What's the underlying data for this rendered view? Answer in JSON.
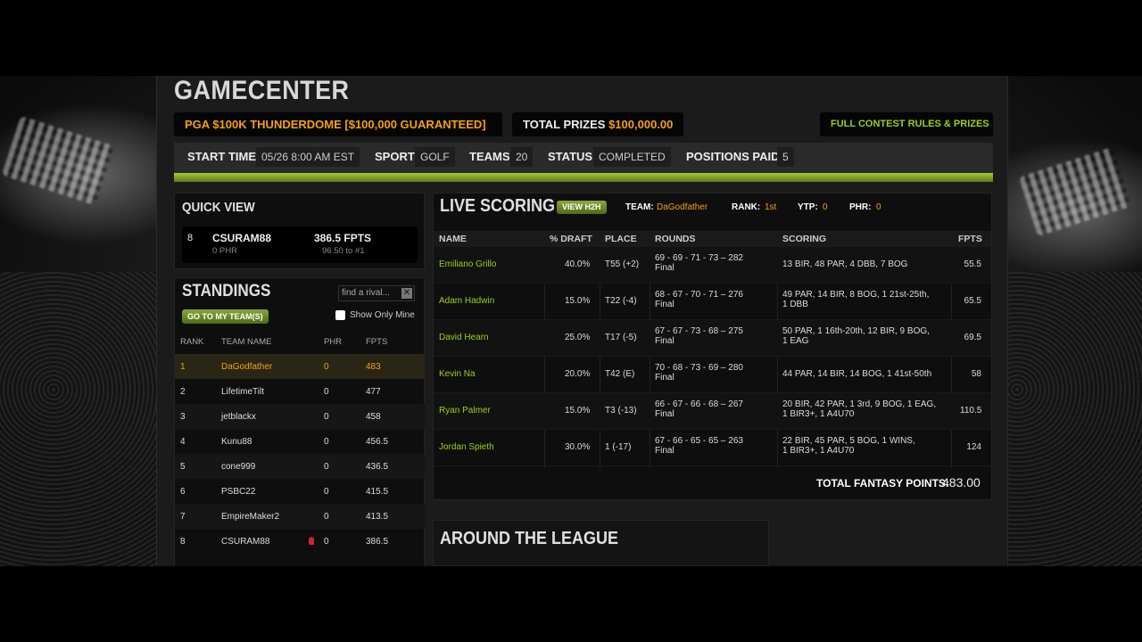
{
  "page": {
    "title": "GAMECENTER",
    "contest_name": "PGA $100K THUNDERDOME [$100,000 GUARANTEED]",
    "total_prizes_label": "TOTAL PRIZES",
    "total_prizes_value": "$100,000.00",
    "rules_link": "FULL CONTEST RULES & PRIZES"
  },
  "info": {
    "start_time_label": "START TIME",
    "start_time": "05/26 8:00 AM EST",
    "sport_label": "SPORT",
    "sport": "GOLF",
    "teams_label": "TEAMS",
    "teams": "20",
    "status_label": "STATUS",
    "status": "COMPLETED",
    "positions_label": "POSITIONS PAID",
    "positions": "5"
  },
  "quick_view": {
    "title": "QUICK VIEW",
    "rank": "8",
    "team": "CSURAM88",
    "phr": "0 PHR",
    "fpts": "386.5 FPTS",
    "to_first": "96.50 to #1"
  },
  "standings": {
    "title": "STANDINGS",
    "search_placeholder": "find a rival...",
    "search_clear": "✕",
    "go_button": "GO TO MY TEAM(S)",
    "show_only_mine": "Show Only Mine",
    "headers": {
      "rank": "RANK",
      "team": "TEAM NAME",
      "phr": "PHR",
      "fpts": "FPTS"
    },
    "rows": [
      {
        "rank": "1",
        "team": "DaGodfather",
        "phr": "0",
        "fpts": "483"
      },
      {
        "rank": "2",
        "team": "LifetimeTilt",
        "phr": "0",
        "fpts": "477"
      },
      {
        "rank": "3",
        "team": "jetblackx",
        "phr": "0",
        "fpts": "458"
      },
      {
        "rank": "4",
        "team": "Kunu88",
        "phr": "0",
        "fpts": "456.5"
      },
      {
        "rank": "5",
        "team": "cone999",
        "phr": "0",
        "fpts": "436.5"
      },
      {
        "rank": "6",
        "team": "PSBC22",
        "phr": "0",
        "fpts": "415.5"
      },
      {
        "rank": "7",
        "team": "EmpireMaker2",
        "phr": "0",
        "fpts": "413.5"
      },
      {
        "rank": "8",
        "team": "CSURAM88",
        "phr": "0",
        "fpts": "386.5"
      }
    ]
  },
  "live_scoring": {
    "title": "LIVE SCORING",
    "h2h_button": "VIEW H2H",
    "team_label": "TEAM:",
    "team": "DaGodfather",
    "rank_label": "RANK:",
    "rank": "1st",
    "ytp_label": "YTP:",
    "ytp": "0",
    "phr_label": "PHR:",
    "phr": "0",
    "headers": {
      "name": "NAME",
      "draft": "% DRAFT",
      "place": "PLACE",
      "rounds": "ROUNDS",
      "scoring": "SCORING",
      "fpts": "FPTS"
    },
    "rows": [
      {
        "name": "Emiliano Grillo",
        "draft": "40.0%",
        "place": "T55 (+2)",
        "rounds": "69 - 69 - 71 - 73 – 282",
        "final": "Final",
        "scoring1": "13 BIR, 48 PAR, 4 DBB, 7 BOG",
        "scoring2": "",
        "fpts": "55.5"
      },
      {
        "name": "Adam Hadwin",
        "draft": "15.0%",
        "place": "T22 (-4)",
        "rounds": "68 - 67 - 70 - 71 – 276",
        "final": "Final",
        "scoring1": "49 PAR, 14 BIR, 8 BOG, 1 21st-25th,",
        "scoring2": "1 DBB",
        "fpts": "65.5"
      },
      {
        "name": "David Hearn",
        "draft": "25.0%",
        "place": "T17 (-5)",
        "rounds": "67 - 67 - 73 - 68 – 275",
        "final": "Final",
        "scoring1": "50 PAR, 1 16th-20th, 12 BIR, 9 BOG,",
        "scoring2": "1 EAG",
        "fpts": "69.5"
      },
      {
        "name": "Kevin Na",
        "draft": "20.0%",
        "place": "T42 (E)",
        "rounds": "70 - 68 - 73 - 69 – 280",
        "final": "Final",
        "scoring1": "44 PAR, 14 BIR, 14 BOG, 1 41st-50th",
        "scoring2": "",
        "fpts": "58"
      },
      {
        "name": "Ryan Palmer",
        "draft": "15.0%",
        "place": "T3 (-13)",
        "rounds": "66 - 67 - 66 - 68 – 267",
        "final": "Final",
        "scoring1": "20 BIR, 42 PAR, 1 3rd, 9 BOG, 1 EAG,",
        "scoring2": "1 BIR3+, 1 A4U70",
        "fpts": "110.5"
      },
      {
        "name": "Jordan Spieth",
        "draft": "30.0%",
        "place": "1 (-17)",
        "rounds": "67 - 66 - 65 - 65 – 263",
        "final": "Final",
        "scoring1": "22 BIR, 45 PAR, 5 BOG, 1 WINS,",
        "scoring2": "1 BIR3+, 1 A4U70",
        "fpts": "124"
      }
    ],
    "total_label": "TOTAL FANTASY POINTS:",
    "total_value": "483.00"
  },
  "around": {
    "title": "AROUND THE LEAGUE"
  },
  "colors": {
    "accent_orange": "#f5a012",
    "accent_green": "#9ad219",
    "panel": "#0e0e0e"
  }
}
